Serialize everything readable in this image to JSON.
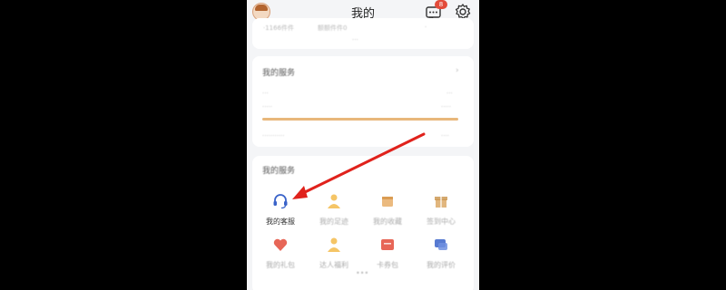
{
  "header": {
    "title": "我的",
    "message_badge": "8"
  },
  "summary_row": {
    "items": [
      "·1166件件",
      "额额件件0",
      "·"
    ],
    "caption": "···"
  },
  "card1": {
    "title": "我的服务",
    "chevron": "›",
    "left_label": "···",
    "right_label": "···",
    "left_sub": "·····",
    "right_sub": "·····",
    "progress": 1.0,
    "footer_text": "···········",
    "footer_right": "····"
  },
  "services": {
    "title": "我的服务",
    "items": [
      {
        "label": "我的客服",
        "icon": "headset-icon",
        "color": "#3a63c9"
      },
      {
        "label": "我的足迹",
        "icon": "person-icon",
        "color": "#f2b640"
      },
      {
        "label": "我的收藏",
        "icon": "box-icon",
        "color": "#e6a95f"
      },
      {
        "label": "签到中心",
        "icon": "gift-icon",
        "color": "#d9a45e"
      },
      {
        "label": "我的礼包",
        "icon": "heart-icon",
        "color": "#e34b3a"
      },
      {
        "label": "达人福利",
        "icon": "person-icon",
        "color": "#f2b640"
      },
      {
        "label": "卡券包",
        "icon": "ticket-icon",
        "color": "#e34b3a"
      },
      {
        "label": "我的评价",
        "icon": "chat-icon",
        "color": "#3a63c9"
      }
    ],
    "dots": "•••"
  },
  "annotation": {
    "arrow_color": "#e0221c"
  }
}
